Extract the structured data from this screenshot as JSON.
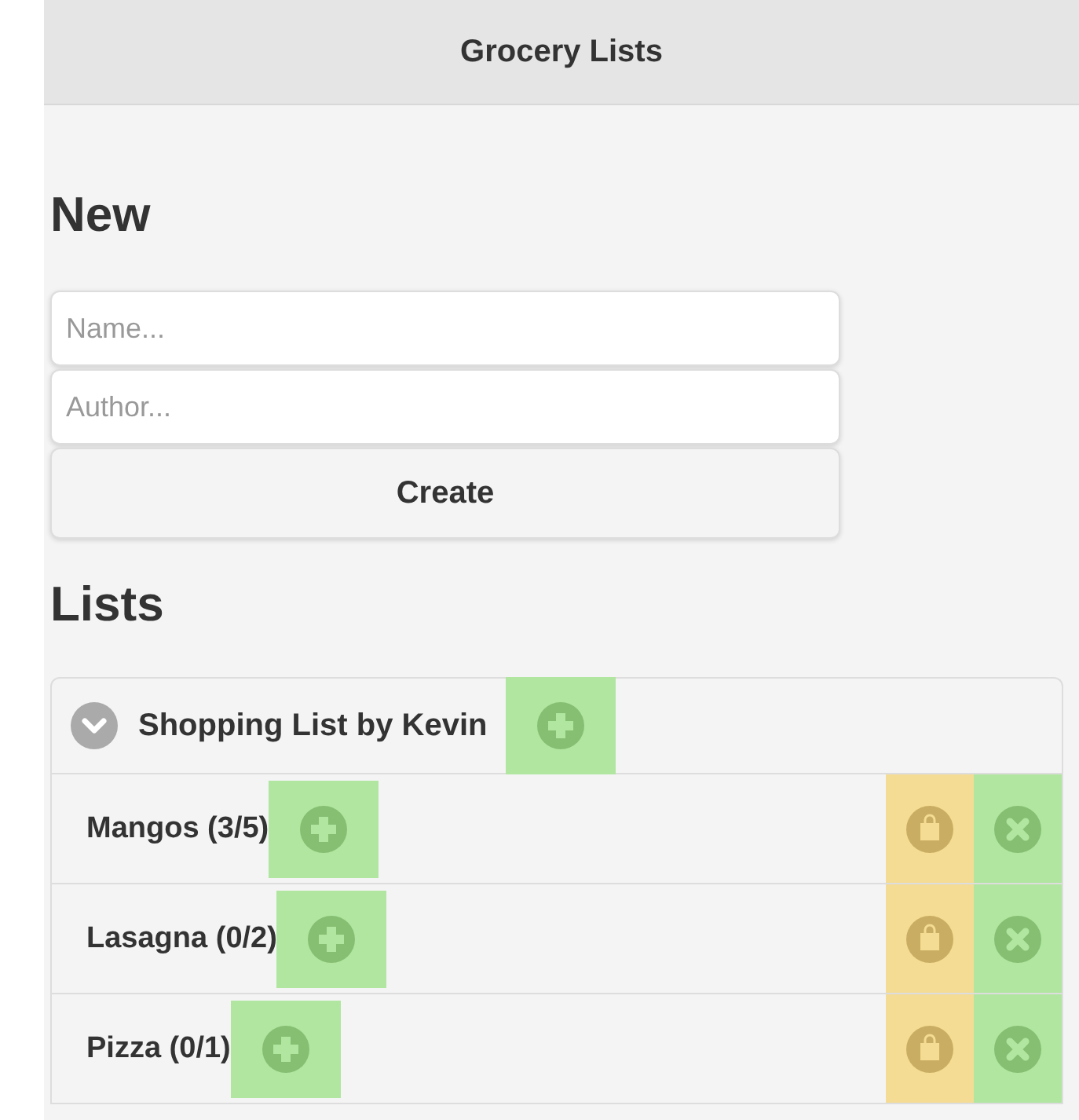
{
  "header": {
    "title": "Grocery Lists"
  },
  "new_section": {
    "heading": "New",
    "name_field": {
      "placeholder": "Name..."
    },
    "author_field": {
      "placeholder": "Author..."
    },
    "create_button": "Create"
  },
  "lists_section": {
    "heading": "Lists",
    "lists": [
      {
        "title": "Shopping List by Kevin",
        "expanded": true,
        "items": [
          {
            "label": "Mangos (3/5)"
          },
          {
            "label": "Lasagna (0/2)"
          },
          {
            "label": "Pizza (0/1)"
          }
        ]
      }
    ]
  }
}
